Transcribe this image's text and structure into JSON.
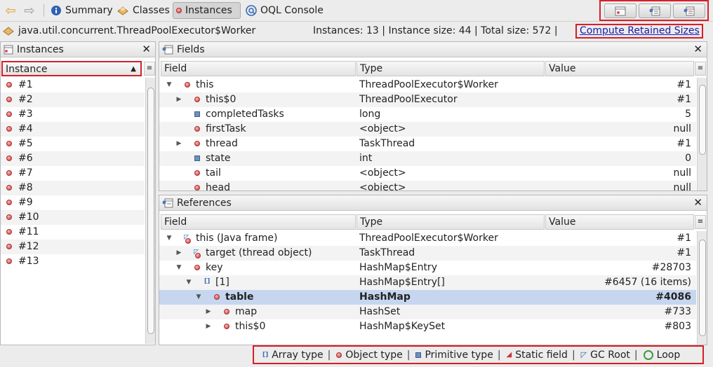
{
  "toolbar": {
    "back_arrow": "left-arrow-icon",
    "forward_arrow": "right-arrow-icon",
    "tabs": [
      {
        "label": "Summary",
        "icon": "info-icon",
        "active": false
      },
      {
        "label": "Classes",
        "icon": "classes-icon",
        "active": false
      },
      {
        "label": "Instances",
        "icon": "instance-icon",
        "active": true
      },
      {
        "label": "OQL Console",
        "icon": "oql-icon",
        "active": false
      }
    ],
    "action_buttons": [
      "instance-view-icon",
      "show-in-tree-icon",
      "show-nearest-gc-root-icon"
    ]
  },
  "class_line": {
    "class_name": "java.util.concurrent.ThreadPoolExecutor$Worker",
    "stats": "Instances: 13  |  Instance size: 44  |  Total size: 572  |",
    "compute_link": "Compute Retained Sizes"
  },
  "instances_panel": {
    "title": "Instances",
    "column": "Instance",
    "items": [
      "#1",
      "#2",
      "#3",
      "#4",
      "#5",
      "#6",
      "#7",
      "#8",
      "#9",
      "#10",
      "#11",
      "#12",
      "#13"
    ]
  },
  "fields_panel": {
    "title": "Fields",
    "columns": [
      "Field",
      "Type",
      "Value"
    ],
    "rows": [
      {
        "expand": "open",
        "indent": 0,
        "icon": "object",
        "name": "this",
        "type": "ThreadPoolExecutor$Worker",
        "value": "#1"
      },
      {
        "expand": "closed",
        "indent": 1,
        "icon": "object",
        "name": "this$0",
        "type": "ThreadPoolExecutor",
        "value": "#1"
      },
      {
        "expand": "",
        "indent": 1,
        "icon": "primitive",
        "name": "completedTasks",
        "type": "long",
        "value": "5"
      },
      {
        "expand": "",
        "indent": 1,
        "icon": "object",
        "name": "firstTask",
        "type": "<object>",
        "value": "null"
      },
      {
        "expand": "closed",
        "indent": 1,
        "icon": "object",
        "name": "thread",
        "type": "TaskThread",
        "value": "#1"
      },
      {
        "expand": "",
        "indent": 1,
        "icon": "primitive",
        "name": "state",
        "type": "int",
        "value": "0"
      },
      {
        "expand": "",
        "indent": 1,
        "icon": "object",
        "name": "tail",
        "type": "<object>",
        "value": "null"
      },
      {
        "expand": "",
        "indent": 1,
        "icon": "object",
        "name": "head",
        "type": "<object>",
        "value": "null"
      }
    ]
  },
  "references_panel": {
    "title": "References",
    "columns": [
      "Field",
      "Type",
      "Value"
    ],
    "rows": [
      {
        "expand": "open",
        "indent": 0,
        "icon": "gcroot",
        "name": "this (Java frame)",
        "type": "ThreadPoolExecutor$Worker",
        "value": "#1",
        "selected": false
      },
      {
        "expand": "closed",
        "indent": 1,
        "icon": "gcroot",
        "name": "target (thread object)",
        "type": "TaskThread",
        "value": "#1",
        "selected": false
      },
      {
        "expand": "open",
        "indent": 1,
        "icon": "object",
        "name": "key",
        "type": "HashMap$Entry",
        "value": "#28703",
        "selected": false
      },
      {
        "expand": "open",
        "indent": 2,
        "icon": "array",
        "name": "[1]",
        "type": "HashMap$Entry[]",
        "value": "#6457 (16 items)",
        "selected": false
      },
      {
        "expand": "open",
        "indent": 3,
        "icon": "object",
        "name": "table",
        "type": "HashMap",
        "value": "#4086",
        "selected": true
      },
      {
        "expand": "closed",
        "indent": 4,
        "icon": "object",
        "name": "map",
        "type": "HashSet",
        "value": "#733",
        "selected": false
      },
      {
        "expand": "closed",
        "indent": 4,
        "icon": "object",
        "name": "this$0",
        "type": "HashMap$KeySet",
        "value": "#803",
        "selected": false
      }
    ]
  },
  "legend": {
    "items": [
      {
        "icon": "array-type-icon",
        "label": "Array type"
      },
      {
        "icon": "object-type-icon",
        "label": "Object type"
      },
      {
        "icon": "primitive-type-icon",
        "label": "Primitive type"
      },
      {
        "icon": "static-field-icon",
        "label": "Static field"
      },
      {
        "icon": "gc-root-icon",
        "label": "GC Root"
      },
      {
        "icon": "loop-icon",
        "label": "Loop"
      }
    ],
    "separator": "|"
  },
  "colors": {
    "highlight_border": "#d61f27",
    "selection": "#c6d6ef",
    "link": "#1a1aaa"
  }
}
